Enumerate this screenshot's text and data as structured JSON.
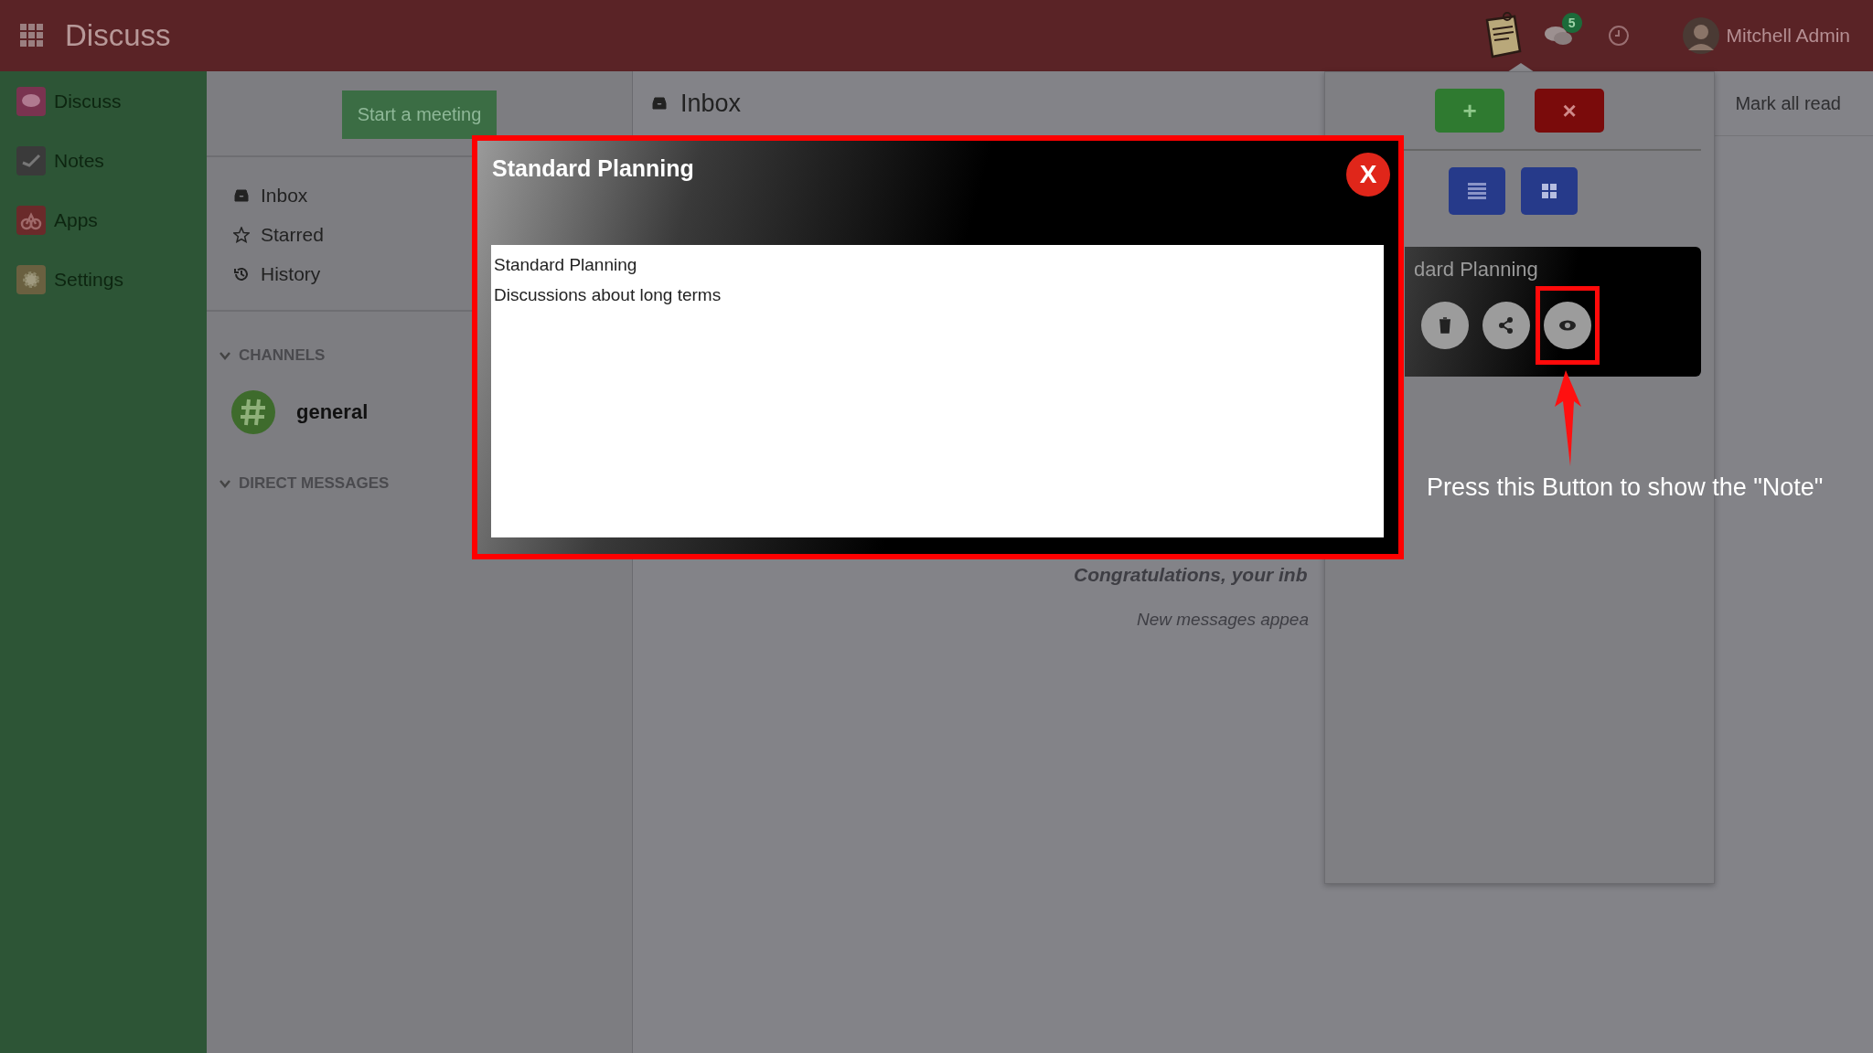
{
  "topbar": {
    "app_title": "Discuss",
    "chat_badge": "5",
    "user_name": "Mitchell Admin"
  },
  "apps_menu": [
    {
      "label": "Discuss",
      "kind": "discuss"
    },
    {
      "label": "Notes",
      "kind": "notes"
    },
    {
      "label": "Apps",
      "kind": "apps"
    },
    {
      "label": "Settings",
      "kind": "settings"
    }
  ],
  "meeting_button": "Start a meeting",
  "mailboxes": [
    {
      "label": "Inbox",
      "kind": "inbox"
    },
    {
      "label": "Starred",
      "kind": "star"
    },
    {
      "label": "History",
      "kind": "history"
    }
  ],
  "channels": {
    "heading": "CHANNELS",
    "expanded": true,
    "items": [
      {
        "name": "general"
      }
    ]
  },
  "direct_messages": {
    "heading": "DIRECT MESSAGES",
    "expanded": true
  },
  "thread": {
    "title": "Inbox",
    "mark_all_read": "Mark all read",
    "empty_title": "Congratulations, your inb",
    "empty_hint": "New messages appea"
  },
  "notes_panel": {
    "add_label": "+",
    "remove_label": "×",
    "view_buttons": [
      {
        "kind": "list"
      },
      {
        "kind": "grid"
      }
    ],
    "card": {
      "title": "dard Planning",
      "actions": [
        {
          "kind": "delete",
          "highlighted": false
        },
        {
          "kind": "share",
          "highlighted": false
        },
        {
          "kind": "view",
          "highlighted": true
        }
      ]
    }
  },
  "modal": {
    "title": "Standard Planning",
    "close_label": "X",
    "body": [
      "Standard Planning",
      "Discussions about long terms"
    ]
  },
  "annotation": "Press this Button to show the \"Note\""
}
